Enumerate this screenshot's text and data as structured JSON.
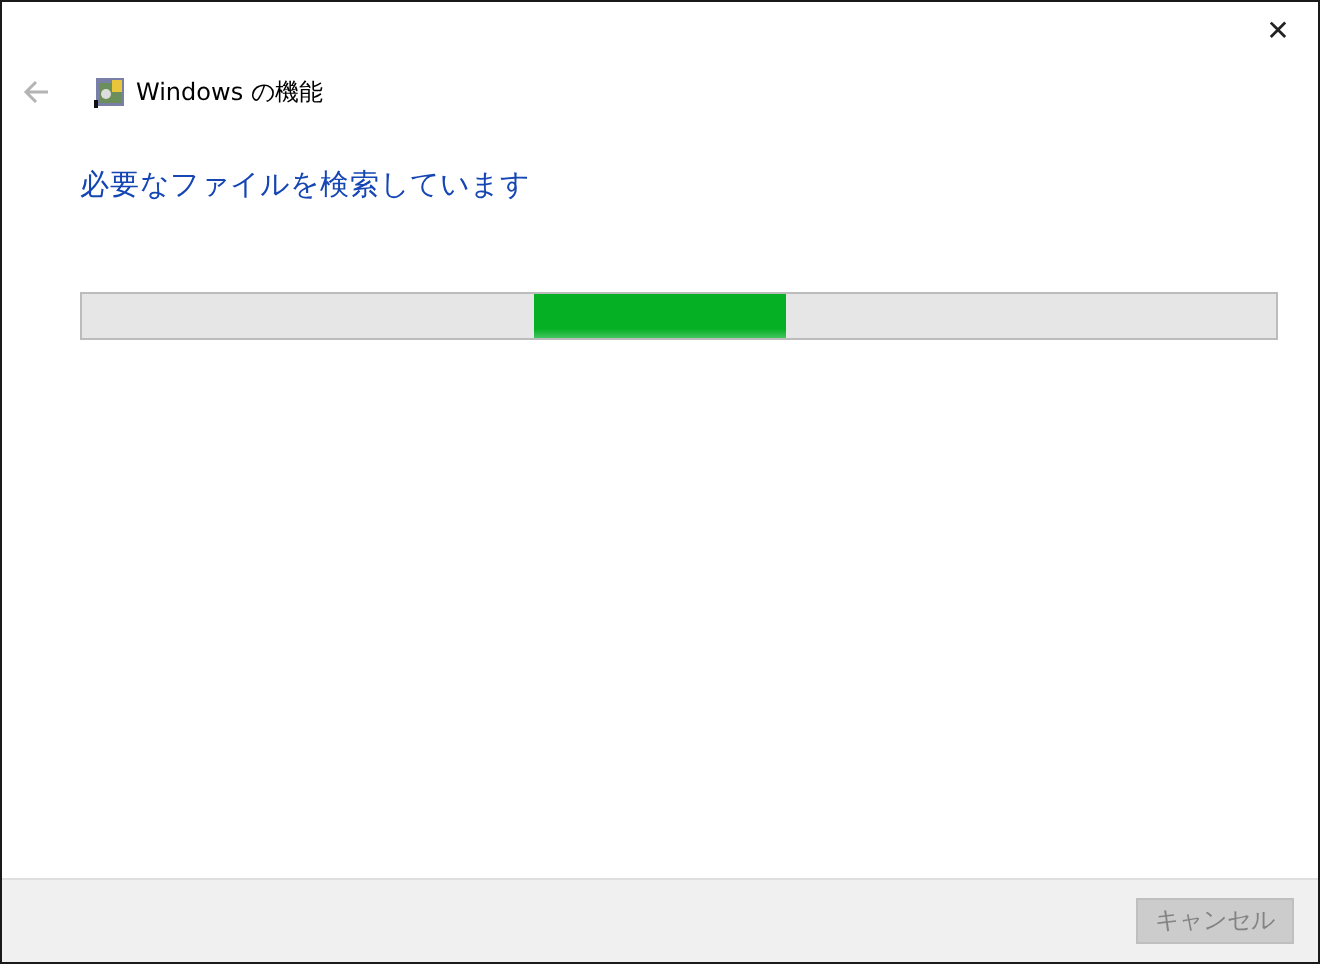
{
  "window": {
    "close": "✕"
  },
  "nav": {
    "back_disabled": true,
    "title": "Windows の機能"
  },
  "heading": "必要なファイルを検索しています",
  "progress": {
    "kind": "marquee"
  },
  "buttons": [
    {
      "label": "キャンセル",
      "disabled": true
    }
  ]
}
